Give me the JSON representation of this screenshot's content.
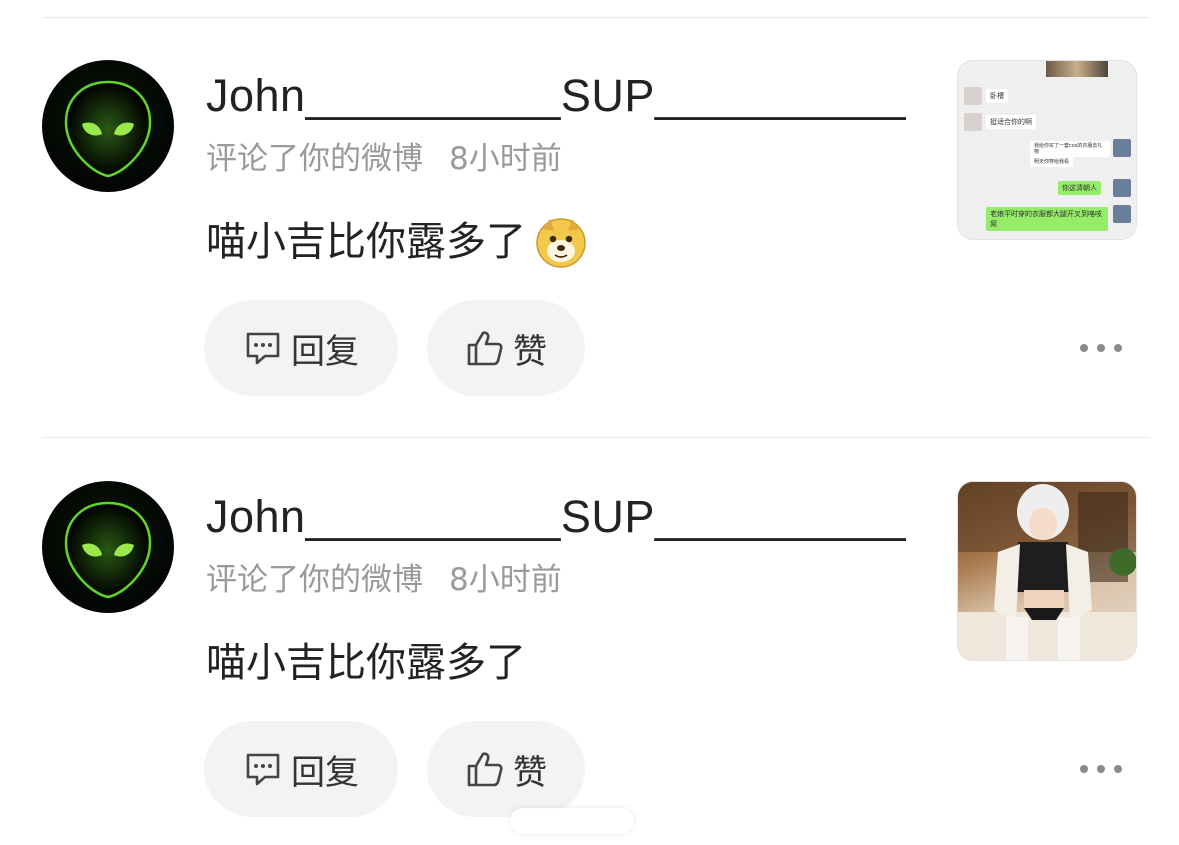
{
  "comments": [
    {
      "username": "John__________SUP__________...",
      "action": "评论了你的微博",
      "time": "8小时前",
      "content": "喵小吉比你露多了",
      "emoji": "doge-emoji",
      "reply_label": "回复",
      "like_label": "赞",
      "thumbnail": {
        "kind": "chat-screenshot",
        "messages": [
          {
            "text": "卧槽",
            "side": "left"
          },
          {
            "text": "挺适合你的啊",
            "side": "left"
          },
          {
            "text": "我给你买了一套cos的衣服去礼物",
            "side": "right-white"
          },
          {
            "text": "明天你穿给我看",
            "side": "right-white"
          },
          {
            "text": "你这清朝人",
            "side": "right-green"
          },
          {
            "text": "老娘平时穿的衣服都大腿开叉到咯吱窝",
            "side": "right-green"
          }
        ]
      }
    },
    {
      "username": "John__________SUP__________...",
      "action": "评论了你的微博",
      "time": "8小时前",
      "content": "喵小吉比你露多了",
      "emoji": "",
      "reply_label": "回复",
      "like_label": "赞",
      "thumbnail": {
        "kind": "cosplay-photo"
      }
    }
  ],
  "colors": {
    "pill_bg": "#f3f3f3",
    "meta_text": "#9a9a9a",
    "divider": "#e9e9e9",
    "chat_green": "#95ec69"
  },
  "icons": [
    "alien-avatar-icon",
    "comment-icon",
    "thumbs-up-icon",
    "more-icon",
    "doge-emoji"
  ]
}
